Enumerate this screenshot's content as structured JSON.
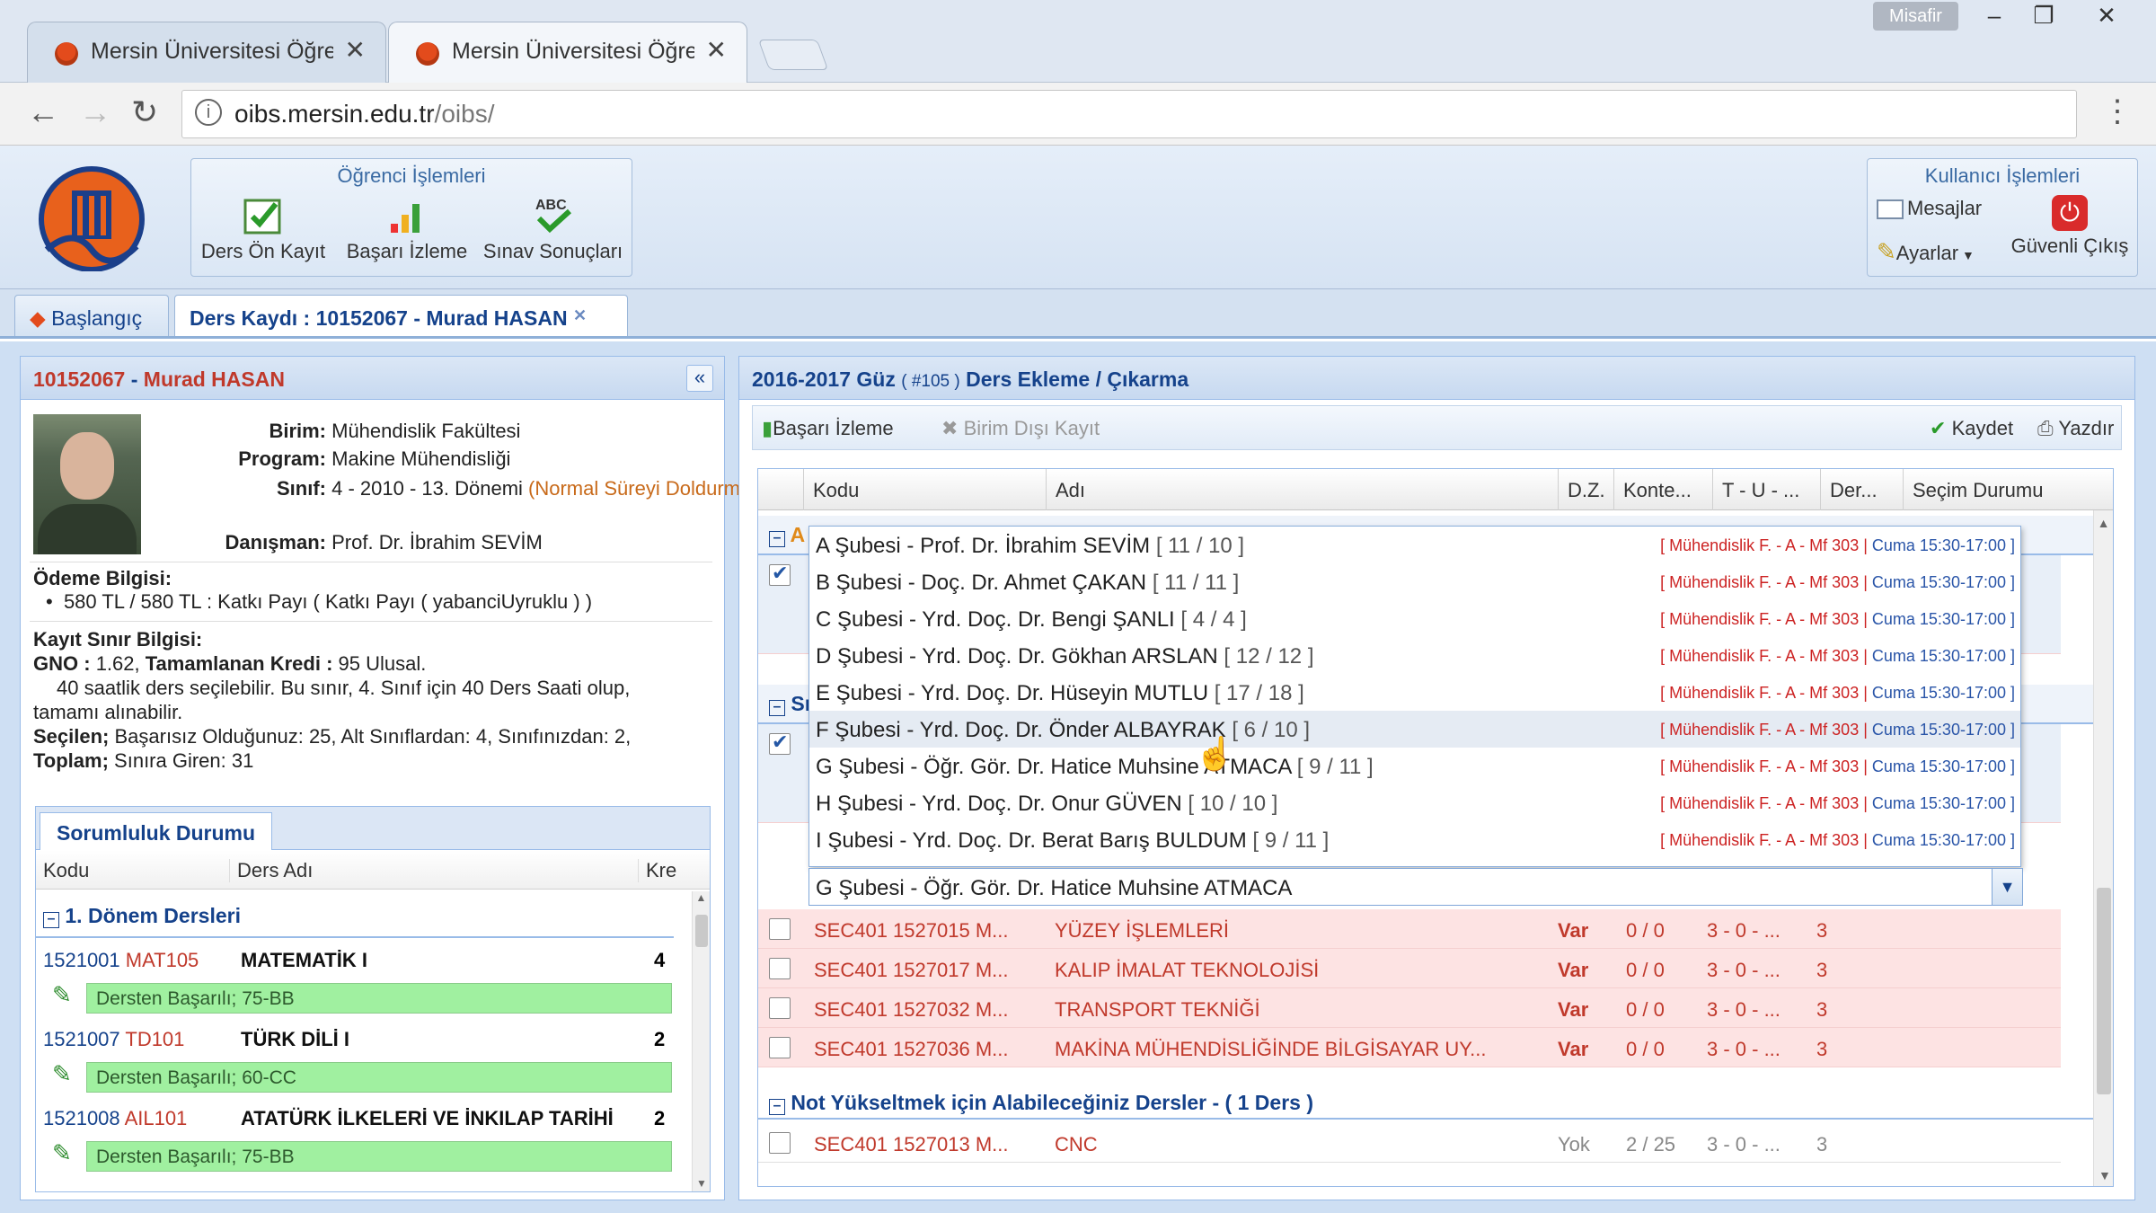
{
  "browser": {
    "tabs": [
      {
        "title": "Mersin Üniversitesi Öğre",
        "active": false
      },
      {
        "title": "Mersin Üniversitesi Öğre",
        "active": true
      }
    ],
    "guest_label": "Misafir",
    "url_host": "oibs.mersin.edu.tr",
    "url_path": "/oibs/"
  },
  "header": {
    "student_ops": {
      "title": "Öğrenci İşlemleri",
      "buttons": [
        "Ders Ön Kayıt",
        "Başarı İzleme",
        "Sınav Sonuçları"
      ]
    },
    "user_ops": {
      "title": "Kullanıcı İşlemleri",
      "messages": "Mesajlar",
      "settings": "Ayarlar",
      "logout": "Güvenli Çıkış"
    }
  },
  "page_tabs": {
    "home": "Başlangıç",
    "active": "Ders Kaydı : 10152067 - Murad HASAN"
  },
  "student": {
    "id": "10152067",
    "name": "Murad HASAN",
    "birim_label": "Birim:",
    "birim": "Mühendislik Fakültesi",
    "program_label": "Program:",
    "program": "Makine Mühendisliği",
    "sinif_label": "Sınıf:",
    "sinif": "4 - 2010 - 13. Dönemi",
    "sinif_note": "(Normal Süreyi Doldurmuş)",
    "danisman_label": "Danışman:",
    "danisman": "Prof. Dr. İbrahim SEVİM",
    "odeme_title": "Ödeme Bilgisi:",
    "odeme_item": "580 TL / 580 TL : Katkı Payı ( Katkı Payı ( yabanciUyruklu ) )",
    "kayit_title": "Kayıt Sınır Bilgisi:",
    "gno_label": "GNO :",
    "gno": "1.62,",
    "kredi_label": "Tamamlanan Kredi :",
    "kredi": "95 Ulusal.",
    "limit_line1": "40 saatlik ders seçilebilir. Bu sınır, 4. Sınıf için 40 Ders Saati olup,",
    "limit_line2": "tamamı alınabilir.",
    "secilen_label": "Seçilen;",
    "secilen": "Başarısız Olduğunuz: 25, Alt Sınıflardan: 4, Sınıfınızdan: 2,",
    "toplam_label": "Toplam;",
    "toplam": "Sınıra Giren: 31"
  },
  "sorumluluk": {
    "tab": "Sorumluluk Durumu",
    "cols": [
      "Kodu",
      "Ders Adı",
      "Kre"
    ],
    "group": "1. Dönem Dersleri",
    "courses": [
      {
        "no": "1521001",
        "code": "MAT105",
        "name": "MATEMATİK I",
        "credit": "4",
        "status": "Dersten Başarılı; 75-BB"
      },
      {
        "no": "1521007",
        "code": "TD101",
        "name": "TÜRK DİLİ I",
        "credit": "2",
        "status": "Dersten Başarılı; 60-CC"
      },
      {
        "no": "1521008",
        "code": "AIL101",
        "name": "ATATÜRK İLKELERİ VE İNKILAP TARİHİ",
        "credit": "2",
        "status": "Dersten Başarılı; 75-BB"
      }
    ]
  },
  "right": {
    "term": "2016-2017 Güz",
    "term_id": "( #105 )",
    "title": "Ders Ekleme / Çıkarma",
    "toolbar": {
      "basari": "Başarı İzleme",
      "birim_disi": "Birim Dışı Kayıt",
      "kaydet": "Kaydet",
      "yazdir": "Yazdır"
    },
    "columns": [
      "Kodu",
      "Adı",
      "D.Z.",
      "Konte...",
      "T - U - ...",
      "Der...",
      "Seçim Durumu"
    ],
    "group_a_letter": "A",
    "group_s_letter": "Sı",
    "rows": [
      {
        "kod": "SEC401 1527015 M...",
        "ad": "YÜZEY İŞLEMLERİ",
        "dz": "Var",
        "kont": "0 / 0",
        "tu": "3 - 0 - ...",
        "der": "3"
      },
      {
        "kod": "SEC401 1527017 M...",
        "ad": "KALIP İMALAT TEKNOLOJİSİ",
        "dz": "Var",
        "kont": "0 / 0",
        "tu": "3 - 0 - ...",
        "der": "3"
      },
      {
        "kod": "SEC401 1527032 M...",
        "ad": "TRANSPORT TEKNİĞİ",
        "dz": "Var",
        "kont": "0 / 0",
        "tu": "3 - 0 - ...",
        "der": "3"
      },
      {
        "kod": "SEC401 1527036 M...",
        "ad": "MAKİNA MÜHENDİSLİĞİNDE BİLGİSAYAR UY...",
        "dz": "Var",
        "kont": "0 / 0",
        "tu": "3 - 0 - ...",
        "der": "3"
      }
    ],
    "group_not": "Not Yükseltmek için Alabileceğiniz Dersler - ( 1 Ders )",
    "not_row": {
      "kod": "SEC401 1527013 M...",
      "ad": "CNC",
      "dz": "Yok",
      "kont": "2 / 25",
      "tu": "3 - 0 - ...",
      "der": "3"
    },
    "dropdown": [
      {
        "label": "A Şubesi - Prof. Dr. İbrahim SEVİM",
        "count": "[ 11 / 10 ]"
      },
      {
        "label": "B Şubesi - Doç. Dr. Ahmet ÇAKAN",
        "count": "[ 11 / 11 ]"
      },
      {
        "label": "C Şubesi - Yrd. Doç. Dr. Bengi ŞANLI",
        "count": "[ 4 / 4 ]"
      },
      {
        "label": "D Şubesi - Yrd. Doç. Dr. Gökhan ARSLAN",
        "count": "[ 12 / 12 ]"
      },
      {
        "label": "E Şubesi - Yrd. Doç. Dr. Hüseyin MUTLU",
        "count": "[ 17 / 18 ]"
      },
      {
        "label": "F Şubesi - Yrd. Doç. Dr. Önder ALBAYRAK",
        "count": "[ 6 / 10 ]"
      },
      {
        "label": "G Şubesi - Öğr. Gör. Dr. Hatice Muhsine ATMACA",
        "count": "[ 9 / 11 ]"
      },
      {
        "label": "H Şubesi - Yrd. Doç. Dr. Onur GÜVEN",
        "count": "[ 10 / 10 ]"
      },
      {
        "label": "I Şubesi - Yrd. Doç. Dr. Berat Barış BULDUM",
        "count": "[ 9 / 11 ]"
      }
    ],
    "dropdown_loc": "[ Mühendislik F. - A - Mf 303 |",
    "dropdown_time": "Cuma 15:30-17:00 ]",
    "combo_value": "G Şubesi - Öğr. Gör. Dr. Hatice Muhsine ATMACA"
  },
  "colors": {
    "accent": "#15428b",
    "pink_row": "#fde3e3",
    "green_status": "#a0f0a0",
    "code_red": "#c0392b"
  }
}
